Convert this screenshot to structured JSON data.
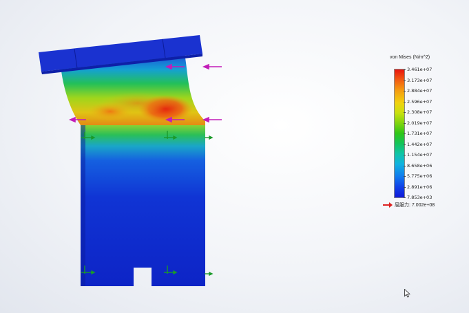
{
  "legend": {
    "title": "von Mises (N/m^2)",
    "ticks": [
      "3.461e+07",
      "3.173e+07",
      "2.884e+07",
      "2.596e+07",
      "2.308e+07",
      "2.019e+07",
      "1.731e+07",
      "1.442e+07",
      "1.154e+07",
      "8.658e+06",
      "5.775e+06",
      "2.891e+06",
      "7.853e+03"
    ],
    "yield_label": "屈服力: 7.002e+08",
    "colors": {
      "max": "#e8140e",
      "min": "#1018d8"
    }
  },
  "icons": {
    "load_arrow": "magenta-force-arrow-icon",
    "fixture": "green-fixture-icon",
    "cursor": "mouse-pointer-icon"
  }
}
